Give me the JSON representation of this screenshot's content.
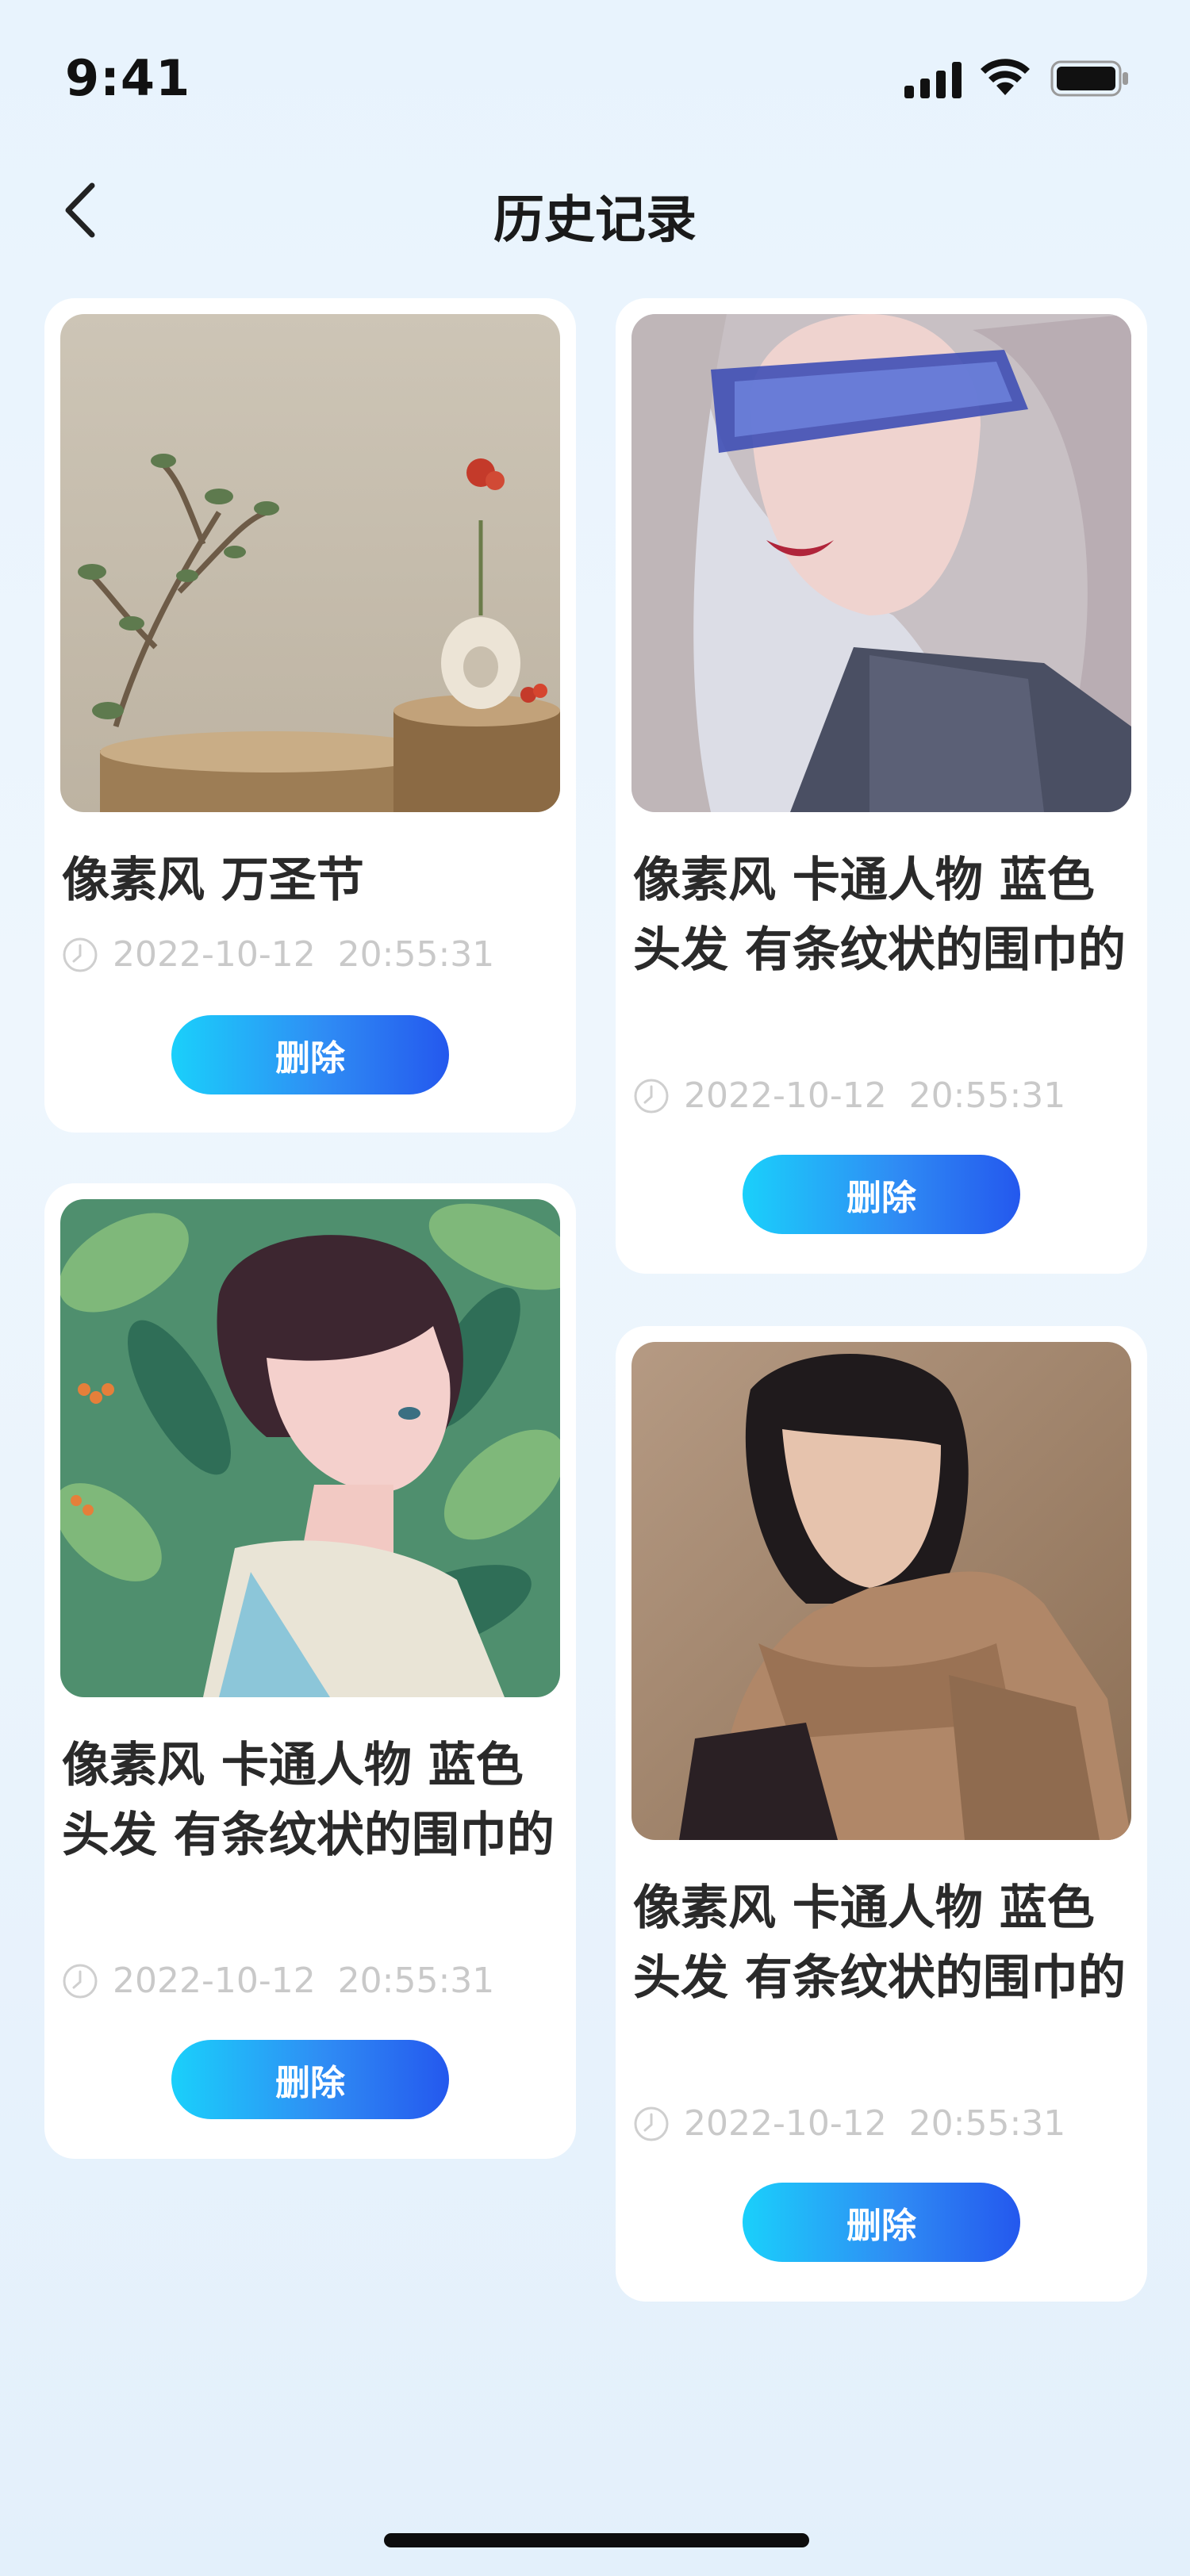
{
  "status_bar": {
    "time": "9:41",
    "icons": [
      "signal-icon",
      "wifi-icon",
      "battery-icon"
    ]
  },
  "nav": {
    "back_icon": "chevron-left-icon",
    "title": "历史记录"
  },
  "colors": {
    "button_gradient_start": "#1ad0fb",
    "button_gradient_end": "#2458ee",
    "timestamp": "#c9c9c9",
    "card_bg": "#ffffff"
  },
  "cards": [
    {
      "image": "still-life-tree-stumps-vase-image",
      "title": "像素风 万圣节",
      "timestamp": "2022-10-12  20:55:31",
      "delete_label": "删除"
    },
    {
      "image": "woman-blue-visor-glasses-image",
      "title": "像素风 卡通人物 蓝色头发 有条纹状的围巾的",
      "timestamp": "2022-10-12  20:55:31",
      "delete_label": "删除"
    },
    {
      "image": "anime-boy-in-leaves-image",
      "title": "像素风 卡通人物 蓝色头发 有条纹状的围巾的",
      "timestamp": "2022-10-12  20:55:31",
      "delete_label": "删除"
    },
    {
      "image": "woman-brown-scarf-portrait-image",
      "title": "像素风 卡通人物 蓝色头发 有条纹状的围巾的",
      "timestamp": "2022-10-12  20:55:31",
      "delete_label": "删除"
    }
  ]
}
